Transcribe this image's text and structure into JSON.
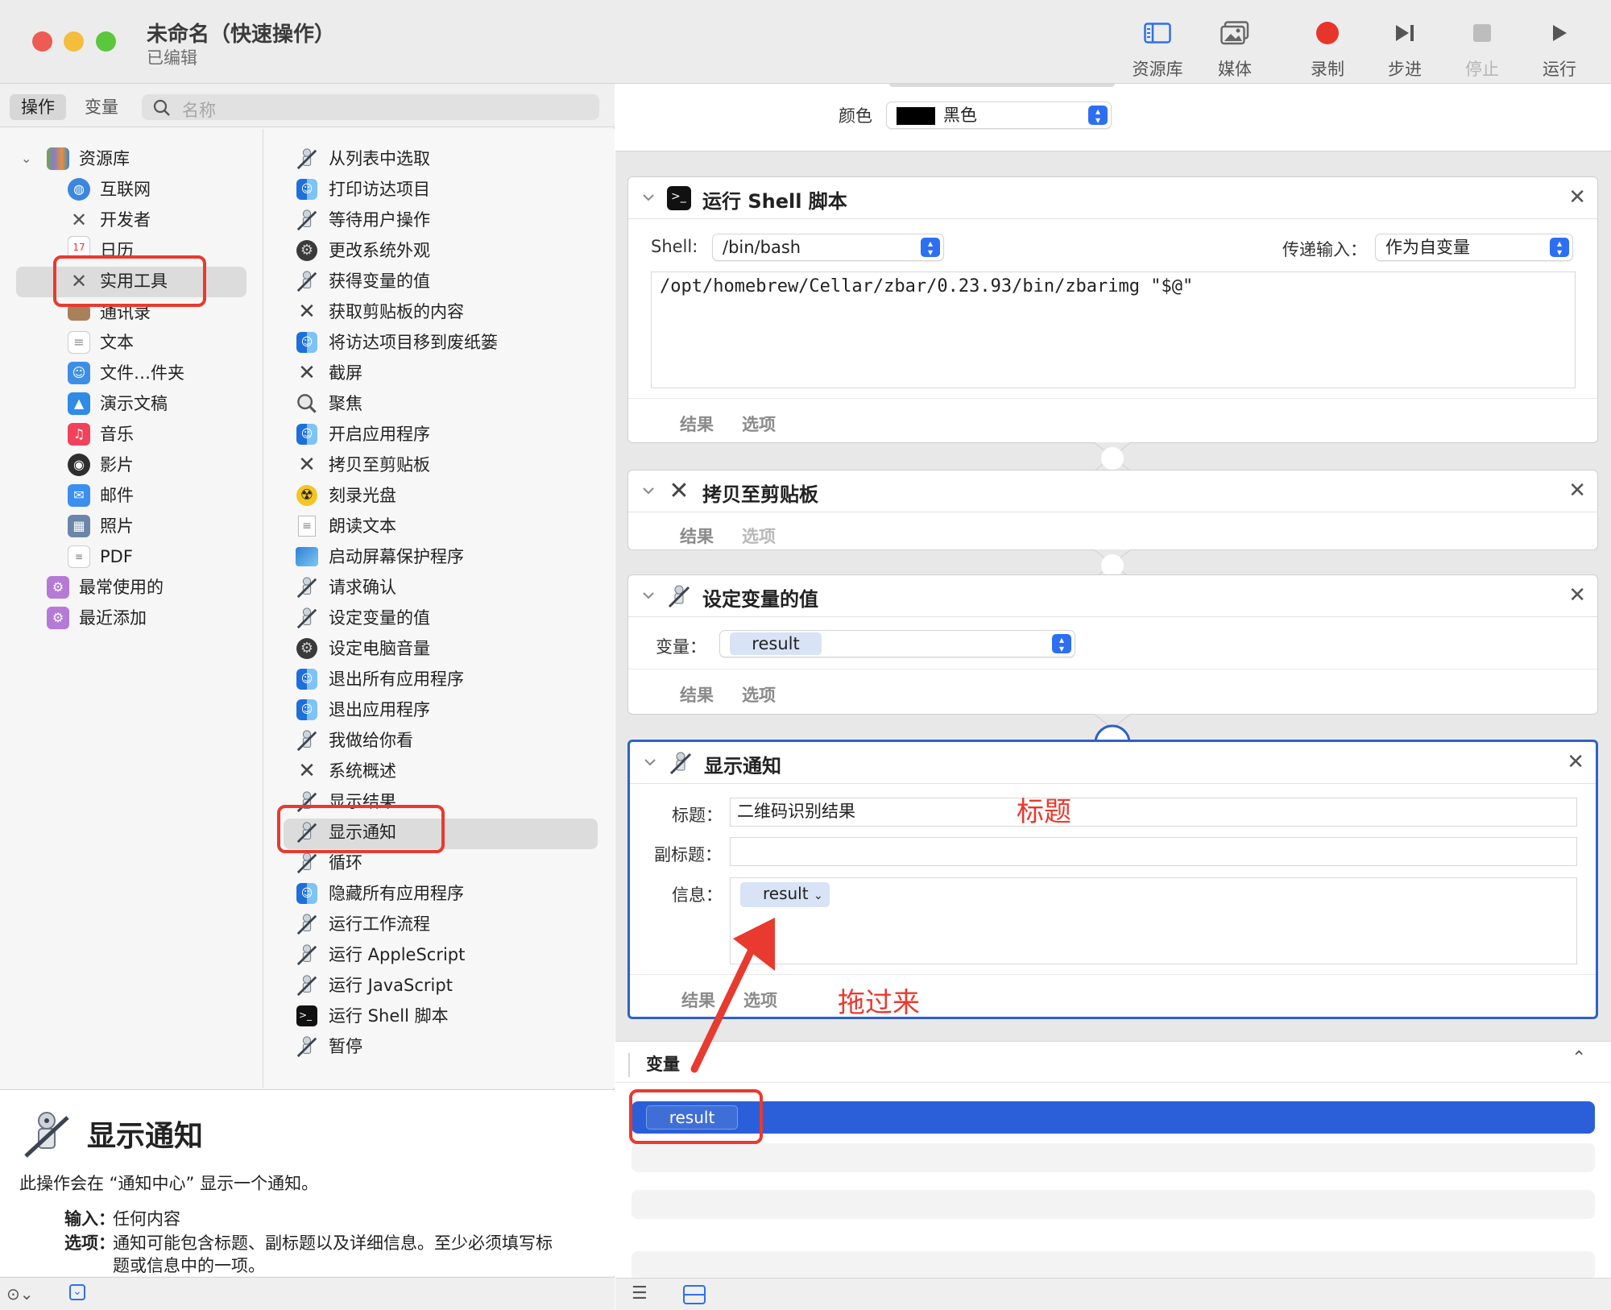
{
  "window": {
    "title": "未命名（快速操作）",
    "subtitle": "已编辑"
  },
  "toolbar": {
    "library": "资源库",
    "media": "媒体",
    "record": "录制",
    "step": "步进",
    "stop": "停止",
    "run": "运行"
  },
  "left_tabs": {
    "actions": "操作",
    "variables": "变量",
    "search_placeholder": "名称"
  },
  "categories": [
    {
      "label": "资源库"
    },
    {
      "label": "互联网"
    },
    {
      "label": "开发者"
    },
    {
      "label": "日历"
    },
    {
      "label": "实用工具"
    },
    {
      "label": "通讯录"
    },
    {
      "label": "文本"
    },
    {
      "label": "文件…件夹"
    },
    {
      "label": "演示文稿"
    },
    {
      "label": "音乐"
    },
    {
      "label": "影片"
    },
    {
      "label": "邮件"
    },
    {
      "label": "照片"
    },
    {
      "label": "PDF"
    },
    {
      "label": "最常使用的"
    },
    {
      "label": "最近添加"
    }
  ],
  "actions": [
    "从列表中选取",
    "打印访达项目",
    "等待用户操作",
    "更改系统外观",
    "获得变量的值",
    "获取剪贴板的内容",
    "将访达项目移到废纸篓",
    "截屏",
    "聚焦",
    "开启应用程序",
    "拷贝至剪贴板",
    "刻录光盘",
    "朗读文本",
    "启动屏幕保护程序",
    "请求确认",
    "设定变量的值",
    "设定电脑音量",
    "退出所有应用程序",
    "退出应用程序",
    "我做给你看",
    "系统概述",
    "显示结果",
    "显示通知",
    "循环",
    "隐藏所有应用程序",
    "运行工作流程",
    "运行 AppleScript",
    "运行 JavaScript",
    "运行 Shell 脚本",
    "暂停"
  ],
  "description": {
    "title": "显示通知",
    "text": "此操作会在 “通知中心” 显示一个通知。",
    "input_label": "输入：",
    "input_value": "任何内容",
    "options_label": "选项：",
    "options_value_1": "通知可能包含标题、副标题以及详细信息。至少必须填写标",
    "options_value_2": "题或信息中的一项。"
  },
  "workflow": {
    "color_label": "颜色",
    "color_value": "黑色",
    "shell_card": {
      "title": "运行 Shell 脚本",
      "shell_label": "Shell:",
      "shell_value": "/bin/bash",
      "pass_label": "传递输入：",
      "pass_value": "作为自变量",
      "script": "/opt/homebrew/Cellar/zbar/0.23.93/bin/zbarimg \"$@\"",
      "results": "结果",
      "options": "选项"
    },
    "copy_card": {
      "title": "拷贝至剪贴板",
      "results": "结果",
      "options": "选项"
    },
    "setvar_card": {
      "title": "设定变量的值",
      "var_label": "变量：",
      "var_value": "result",
      "results": "结果",
      "options": "选项"
    },
    "notify_card": {
      "title": "显示通知",
      "title_label": "标题：",
      "title_value": "二维码识别结果",
      "subtitle_label": "副标题：",
      "subtitle_value": "",
      "message_label": "信息：",
      "message_token": "result",
      "results": "结果",
      "options": "选项"
    }
  },
  "variables_panel": {
    "title": "变量",
    "items": [
      "result"
    ]
  },
  "annotations": {
    "title_note": "标题",
    "drag_note": "拖过来"
  },
  "colors": {
    "accent": "#2d6ff0",
    "selection": "#2b5fd9",
    "annotation": "#e83a2f"
  }
}
